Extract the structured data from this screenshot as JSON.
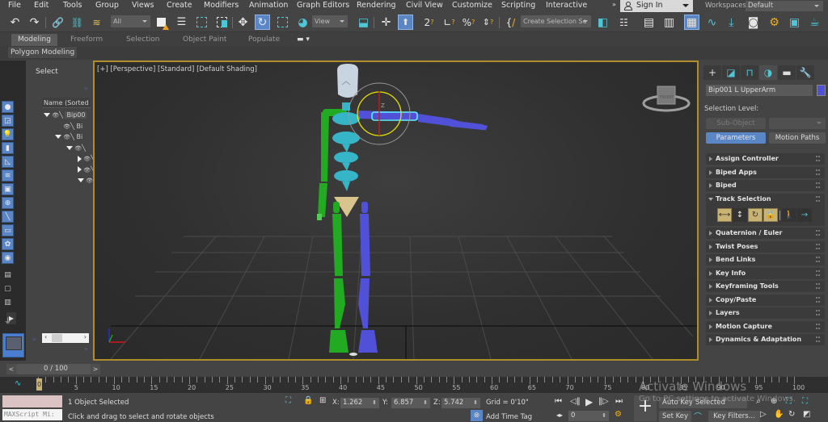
{
  "menu": {
    "items": [
      "File",
      "Edit",
      "Tools",
      "Group",
      "Views",
      "Create",
      "Modifiers",
      "Animation",
      "Graph Editors",
      "Rendering",
      "Civil View",
      "Customize",
      "Scripting",
      "Interactive"
    ],
    "more_label": "»",
    "sign_in_label": "Sign In",
    "workspaces_label": "Workspaces:",
    "workspace_value": "Default"
  },
  "toolbar": {
    "selection_filter": "All",
    "ref_coord": "View",
    "named_selection_placeholder": "Create Selection Se",
    "icons": [
      "undo-icon",
      "redo-icon",
      "link-icon",
      "unlink-icon",
      "bind-space-warp-icon",
      "select-object-icon",
      "select-by-name-icon",
      "rect-region-icon",
      "window-crossing-icon",
      "select-move-icon",
      "select-rotate-icon",
      "select-scale-icon",
      "placement-icon",
      "pivot-icon",
      "axis-constraints-icon",
      "select-manipulate-icon",
      "snaps-icon",
      "angle-snap-icon",
      "percent-snap-icon",
      "spinner-snap-icon",
      "edit-named-selection-icon",
      "mirror-icon",
      "align-icon",
      "scene-explorer-icon",
      "layer-explorer-icon",
      "ribbon-toggle-icon",
      "curve-editor-icon",
      "schematic-view-icon",
      "material-editor-icon",
      "render-setup-icon",
      "rendered-frame-icon",
      "render-icon"
    ]
  },
  "ribbon": {
    "tabs": [
      "Modeling",
      "Freeform",
      "Selection",
      "Object Paint",
      "Populate"
    ],
    "active_tab": "Modeling",
    "sub_panel": "Polygon Modeling"
  },
  "scene_explorer": {
    "title": "Select",
    "column_header": "Name (Sorted A",
    "rows": [
      {
        "indent": 0,
        "expand": "down",
        "label": "Bip00"
      },
      {
        "indent": 1,
        "expand": "none",
        "label": "Bi"
      },
      {
        "indent": 1,
        "expand": "down",
        "label": "Bi"
      },
      {
        "indent": 2,
        "expand": "down",
        "label": ""
      },
      {
        "indent": 3,
        "expand": "right",
        "label": ""
      },
      {
        "indent": 3,
        "expand": "right",
        "label": ""
      },
      {
        "indent": 3,
        "expand": "down",
        "label": ""
      }
    ],
    "filters": [
      "geometry-filter-icon",
      "shapes-filter-icon",
      "lights-filter-icon",
      "cameras-filter-icon",
      "helpers-filter-icon",
      "spacewarps-filter-icon",
      "groups-filter-icon",
      "xrefs-filter-icon",
      "bones-filter-icon",
      "containers-filter-icon",
      "frozen-filter-icon",
      "hidden-filter-icon"
    ]
  },
  "viewport": {
    "label_plus": "[+]",
    "label_view": "[Perspective]",
    "label_shading": "[Standard]",
    "label_mode": "[Default Shading]",
    "viewcube_label": "FRONT",
    "gizmo_axis": "Z",
    "colors": {
      "spine": "#36b4c8",
      "left_limbs": "#22aa22",
      "right_limbs": "#5050d8",
      "pelvis": "#d8c48c",
      "head": "#c8d4e0",
      "selection": "#5ff0ff",
      "border": "#b08d2a"
    }
  },
  "command_panel": {
    "tabs": [
      "create-tab-icon",
      "modify-tab-icon",
      "hierarchy-tab-icon",
      "motion-tab-icon",
      "display-tab-icon",
      "utilities-tab-icon"
    ],
    "active_tab": 3,
    "object_name": "Bip001 L UpperArm",
    "object_color": "#5050d8",
    "selection_level_label": "Selection Level:",
    "sub_object_label": "Sub-Object",
    "parameters_label": "Parameters",
    "motion_paths_label": "Motion Paths",
    "rollouts_top": [
      "Assign Controller",
      "Biped Apps",
      "Biped"
    ],
    "track_selection": "Track Selection",
    "rollouts_bottom": [
      "Quaternion / Euler",
      "Twist Poses",
      "Bend Links",
      "Key Info",
      "Keyframing Tools",
      "Copy/Paste",
      "Layers",
      "Motion Capture",
      "Dynamics & Adaptation"
    ]
  },
  "timeline": {
    "current_frame": "0 / 100",
    "prev_label": "<",
    "next_label": ">",
    "start": 0,
    "end": 100,
    "major_step": 5
  },
  "status": {
    "maxscript_placeholder": "MAXScript Mi:",
    "selection_info": "1 Object Selected",
    "prompt": "Click and drag to select and rotate objects",
    "x_label": "X:",
    "x_value": "1.262",
    "y_label": "Y:",
    "y_value": "6.857",
    "z_label": "Z:",
    "z_value": "5.742",
    "grid": "Grid = 0'10\"",
    "add_time_tag": "Add Time Tag",
    "frame_value": "0",
    "auto_key": "Auto Key",
    "set_key": "Set Key",
    "selected": "Selected",
    "key_filters": "Key Filters...",
    "watermark_title": "Activate Windows",
    "watermark_sub": "Go to PC settings to activate Windows."
  }
}
